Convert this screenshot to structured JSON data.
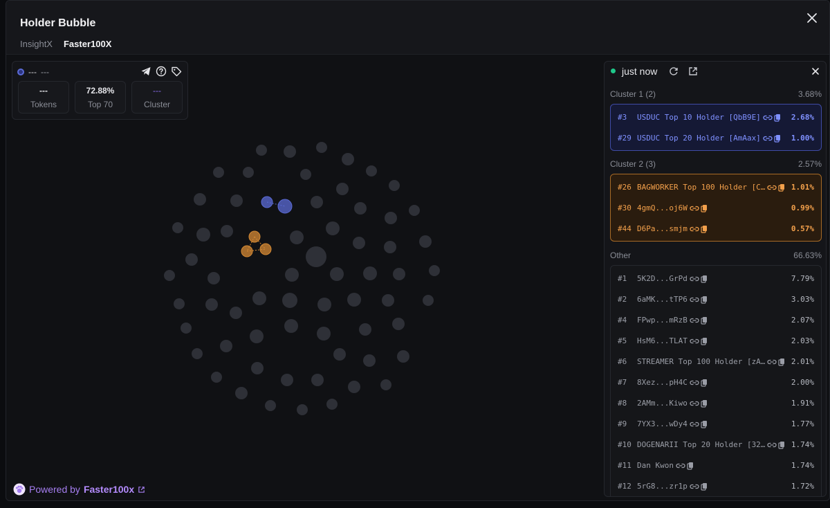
{
  "header": {
    "title": "Holder Bubble",
    "tabs": [
      {
        "label": "InsightX",
        "active": false
      },
      {
        "label": "Faster100X",
        "active": true
      }
    ]
  },
  "stats": {
    "token_name": "---",
    "token_symbol": "---",
    "boxes": [
      {
        "value": "---",
        "label": "Tokens"
      },
      {
        "value": "72.88%",
        "label": "Top 70"
      },
      {
        "value": "---",
        "label": "Cluster"
      }
    ]
  },
  "powered": {
    "prefix": "Powered by",
    "brand": "Faster100x"
  },
  "panel": {
    "updated": "just now",
    "clusters": [
      {
        "title": "Cluster 1 (2)",
        "total": "3.68%",
        "color": "#5b6bd6",
        "rows": [
          {
            "rank": "#3",
            "name": "USDUC Top 10 Holder [QbB9E]",
            "pct": "2.68%"
          },
          {
            "rank": "#29",
            "name": "USDUC Top 20 Holder [AmAax]",
            "pct": "1.00%"
          }
        ]
      },
      {
        "title": "Cluster 2 (3)",
        "total": "2.57%",
        "color": "#d58a34",
        "rows": [
          {
            "rank": "#26",
            "name": "BAGWORKER Top 100 Holder [C…",
            "pct": "1.01%"
          },
          {
            "rank": "#30",
            "name": "4gmQ...oj6W",
            "pct": "0.99%"
          },
          {
            "rank": "#44",
            "name": "D6Pa...smjm",
            "pct": "0.57%"
          }
        ]
      }
    ],
    "other": {
      "title": "Other",
      "total": "66.63%",
      "rows": [
        {
          "rank": "#1",
          "name": "5K2D...GrPd",
          "pct": "7.79%"
        },
        {
          "rank": "#2",
          "name": "6aMK...tTP6",
          "pct": "3.03%"
        },
        {
          "rank": "#4",
          "name": "FPwp...mRzB",
          "pct": "2.07%"
        },
        {
          "rank": "#5",
          "name": "HsM6...TLAT",
          "pct": "2.03%"
        },
        {
          "rank": "#6",
          "name": "STREAMER Top 100 Holder [zA…",
          "pct": "2.01%"
        },
        {
          "rank": "#7",
          "name": "8Xez...pH4C",
          "pct": "2.00%"
        },
        {
          "rank": "#8",
          "name": "2AMm...Kiwo",
          "pct": "1.91%"
        },
        {
          "rank": "#9",
          "name": "7YX3...wDy4",
          "pct": "1.77%"
        },
        {
          "rank": "#10",
          "name": "DOGENARII Top 20 Holder [32…",
          "pct": "1.74%"
        },
        {
          "rank": "#11",
          "name": "Dan Kwon",
          "pct": "1.74%"
        },
        {
          "rank": "#12",
          "name": "5rG8...zr1p",
          "pct": "1.72%"
        }
      ]
    }
  },
  "colors": {
    "cluster1": "#5b6bd6",
    "cluster2": "#d58a34",
    "neutral_bubble": "#2e3037",
    "accent_purple": "#a57ef0",
    "live_green": "#1fc88a"
  }
}
